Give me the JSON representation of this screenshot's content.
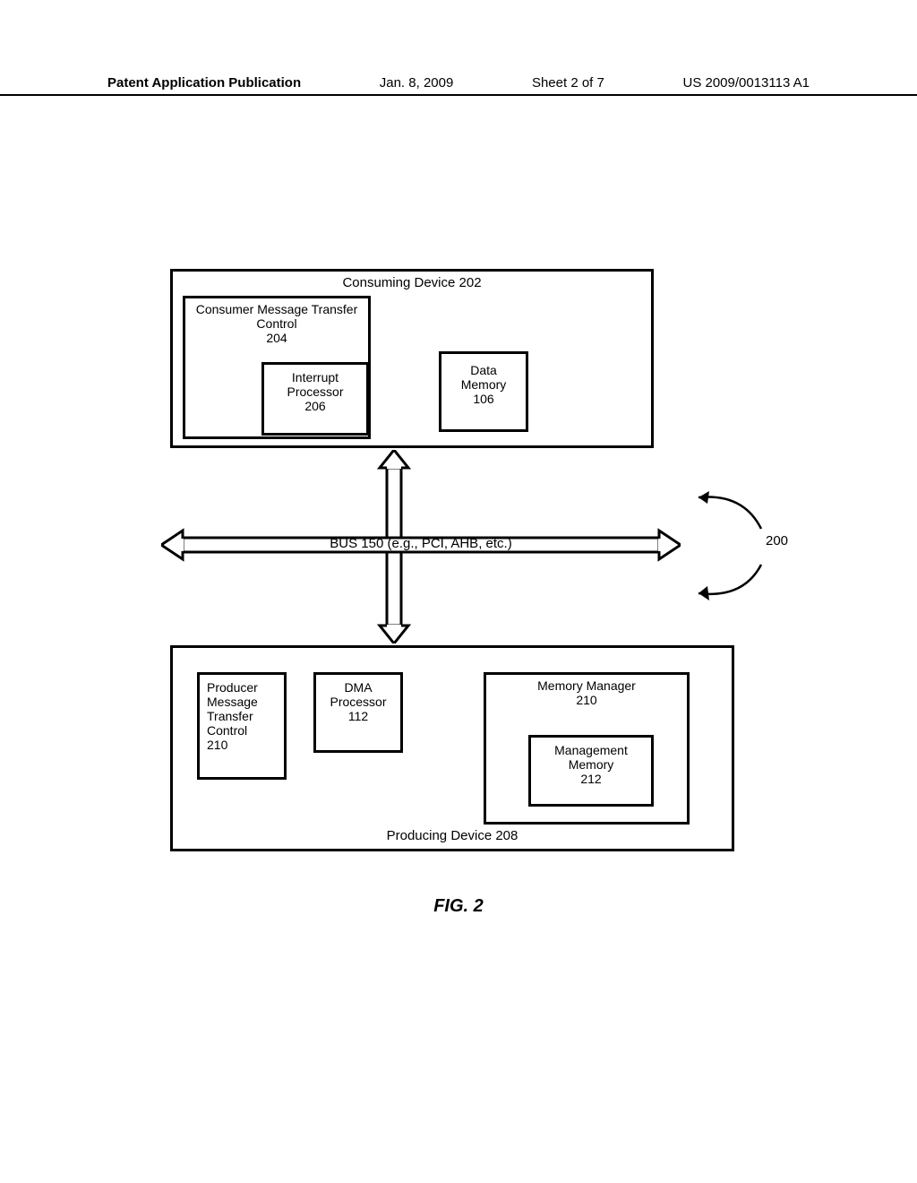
{
  "header": {
    "publication": "Patent Application Publication",
    "date": "Jan. 8, 2009",
    "sheet": "Sheet 2 of 7",
    "appnum": "US 2009/0013113 A1"
  },
  "consuming": {
    "title": "Consuming Device 202",
    "consumer_control": "Consumer Message Transfer\nControl\n204",
    "interrupt_proc": "Interrupt\nProcessor\n206",
    "data_memory": "Data\nMemory\n106"
  },
  "bus": {
    "label": "BUS 150 (e.g., PCI, AHB, etc.)"
  },
  "producing": {
    "title": "Producing Device 208",
    "producer_control": "Producer\nMessage\nTransfer\nControl\n210",
    "dma_proc": "DMA\nProcessor\n112",
    "mem_mgr": "Memory Manager\n210",
    "mgmt_mem": "Management\nMemory\n212"
  },
  "callout": {
    "num": "200"
  },
  "figure": {
    "caption": "FIG. 2"
  }
}
